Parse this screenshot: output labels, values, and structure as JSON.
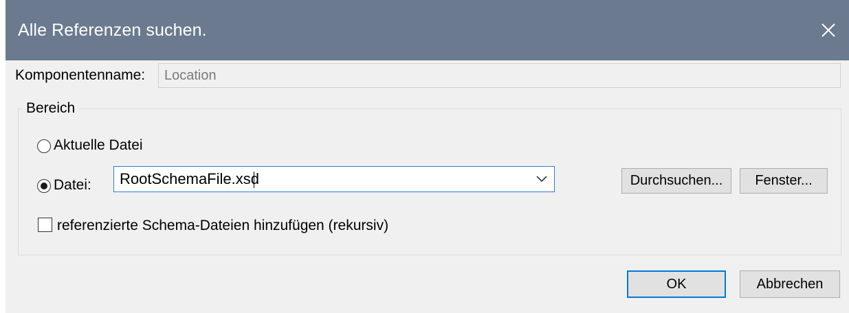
{
  "window": {
    "title": "Alle Referenzen suchen."
  },
  "component": {
    "label": "Komponentenname:",
    "value": "Location"
  },
  "scope": {
    "group_label": "Bereich",
    "current_file_label": "Aktuelle Datei",
    "file_label": "Datei:",
    "file_value": "RootSchemaFile.xsd",
    "selected": "file",
    "browse_label": "Durchsuchen...",
    "window_label": "Fenster...",
    "include_refs_label": "referenzierte Schema-Dateien hinzufügen (rekursiv)",
    "include_refs_checked": false
  },
  "buttons": {
    "ok_label": "OK",
    "cancel_label": "Abbrechen"
  },
  "icons": {
    "close": "close-icon",
    "dropdown": "chevron-down-icon"
  },
  "colors": {
    "titlebar": "#6b7a8e",
    "focus_border": "#2f7bd6",
    "default_button_border": "#0078d7"
  }
}
